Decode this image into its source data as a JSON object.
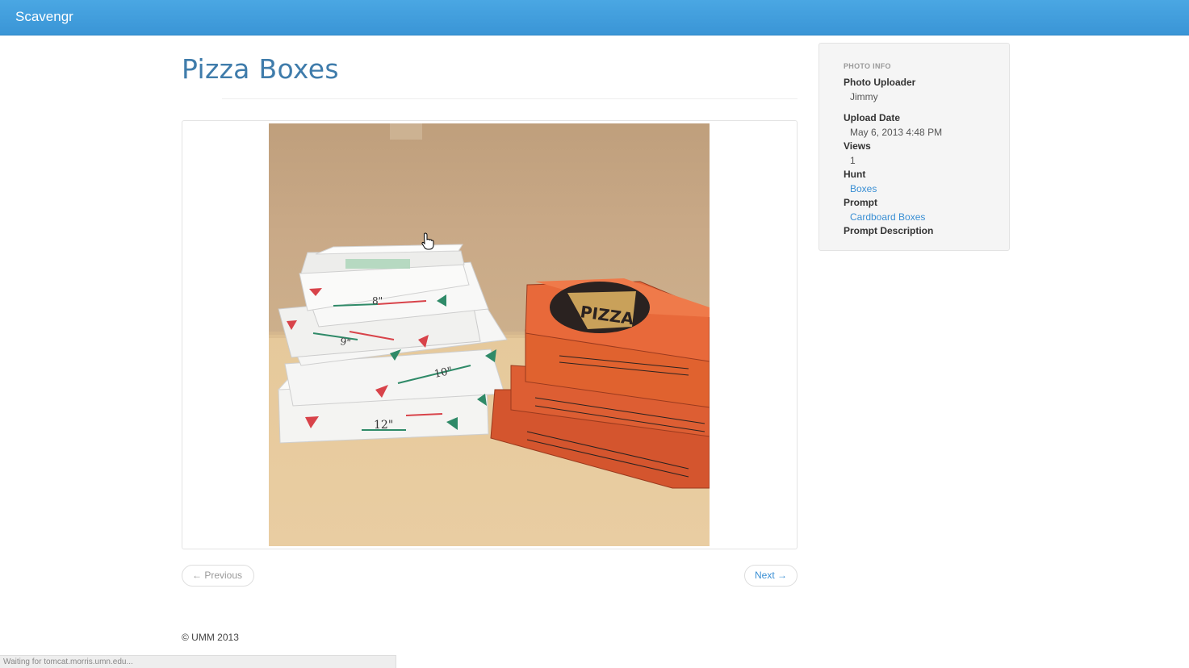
{
  "navbar": {
    "brand": "Scavengr"
  },
  "page": {
    "title": "Pizza Boxes"
  },
  "photo": {
    "alt": "Pizza Boxes",
    "box_labels": [
      "8\"",
      "9\"",
      "10\"",
      "12\""
    ],
    "red_box_label": "PIZZA"
  },
  "pager": {
    "previous_label": "← Previous",
    "next_label": "Next →"
  },
  "sidebar": {
    "header": "PHOTO INFO",
    "uploader_label": "Photo Uploader",
    "uploader_value": "Jimmy",
    "upload_date_label": "Upload Date",
    "upload_date_value": "May 6, 2013 4:48 PM",
    "views_label": "Views",
    "views_value": "1",
    "hunt_label": "Hunt",
    "hunt_value": "Boxes",
    "prompt_label": "Prompt",
    "prompt_value": "Cardboard Boxes",
    "prompt_description_label": "Prompt Description"
  },
  "footer": {
    "copyright": "© UMM 2013"
  },
  "status_bar": {
    "text": "Waiting for tomcat.morris.umn.edu..."
  },
  "colors": {
    "navbar": "#3a95d6",
    "title": "#3f7cab",
    "link": "#3a8fd4",
    "sidebar_bg": "#f5f5f5"
  }
}
